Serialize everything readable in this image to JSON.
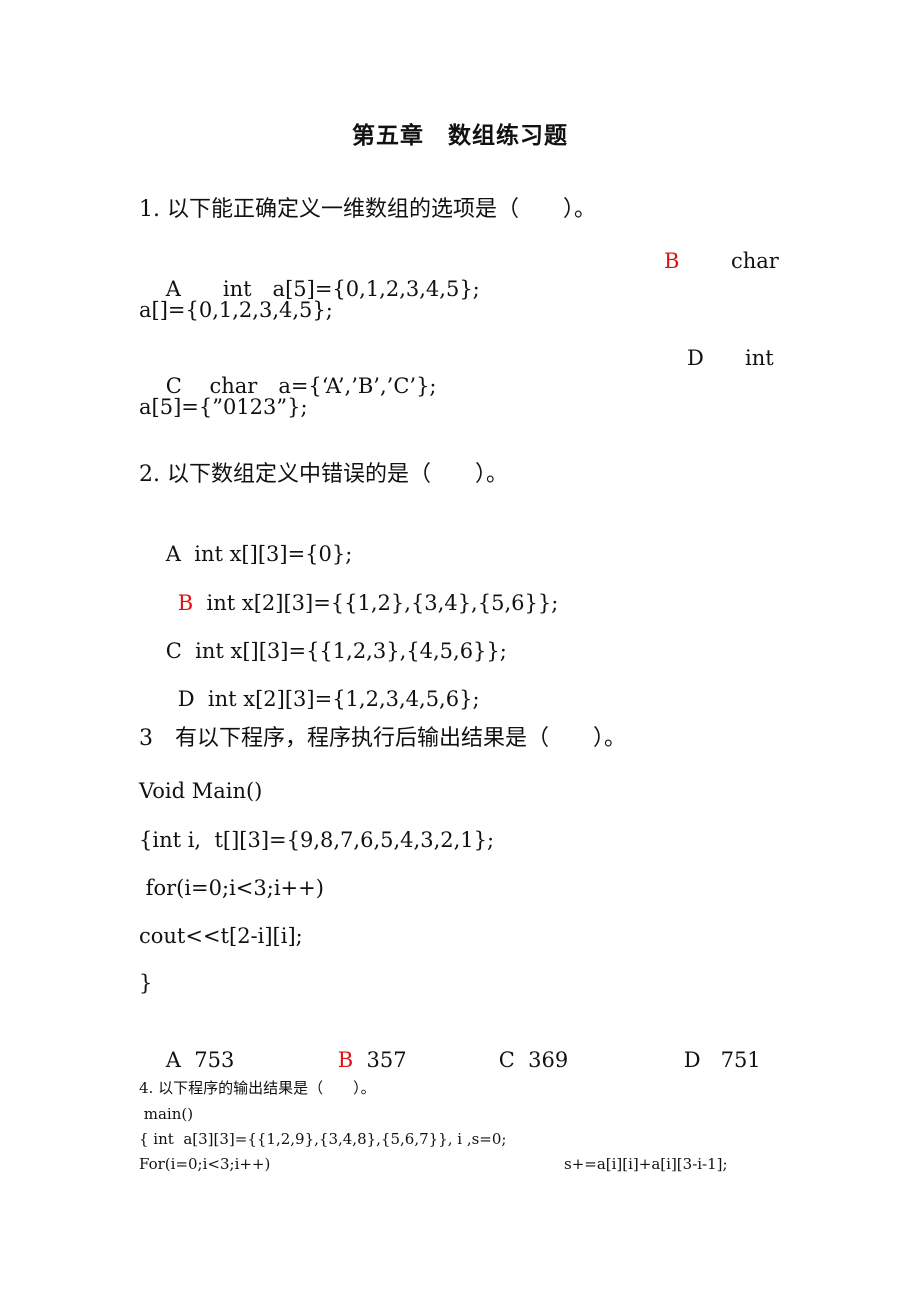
{
  "document": {
    "title": "第五章　数组练习题",
    "answer_color": "#e01010"
  },
  "q1": {
    "question": "1. 以下能正确定义一维数组的选项是（　　）。",
    "options": [
      {
        "letter": "A",
        "text_line1": "int　a[5]={0,1,2,3,4,5};",
        "text_line2": ""
      },
      {
        "letter": "B",
        "text_line1": "char",
        "text_line2": "a[]={0,1,2,3,4,5};",
        "is_answer": true
      },
      {
        "letter": "C",
        "text_line1": "char　a={‘A’,’B’,’C’};",
        "text_line2": ""
      },
      {
        "letter": "D",
        "text_line1": "int",
        "text_line2": "a[5]={”0123”};"
      }
    ]
  },
  "q2": {
    "question": "2. 以下数组定义中错误的是（　　）。",
    "options": [
      {
        "letter": "A",
        "text": "int x[][3]={0};"
      },
      {
        "letter": "B",
        "text": "int x[2][3]={{1,2},{3,4},{5,6}};",
        "is_answer": true
      },
      {
        "letter": "C",
        "text": "int x[][3]={{1,2,3},{4,5,6}};"
      },
      {
        "letter": "D",
        "text": "int x[2][3]={1,2,3,4,5,6};"
      }
    ]
  },
  "q3": {
    "question": "3　有以下程序，程序执行后输出结果是（　　）。",
    "code": [
      "Void Main()",
      "{int i,  t[][3]={9,8,7,6,5,4,3,2,1};",
      " for(i=0;i<3;i++)",
      "cout<<t[2-i][i];",
      "}"
    ],
    "options": [
      {
        "letter": "A",
        "text": "753"
      },
      {
        "letter": "B",
        "text": "357",
        "is_answer": true
      },
      {
        "letter": "C",
        "text": "369"
      },
      {
        "letter": "D",
        "text": "751"
      }
    ]
  },
  "q4": {
    "question": "4. 以下程序的输出结果是（　　）。",
    "code": [
      " main()",
      "{ int  a[3][3]={{1,2,9},{3,4,8},{5,6,7}}, i ,s=0;",
      "For(i=0;i<3;i++)"
    ],
    "code_right": "s+=a[i][i]+a[i][3-i-1];"
  }
}
